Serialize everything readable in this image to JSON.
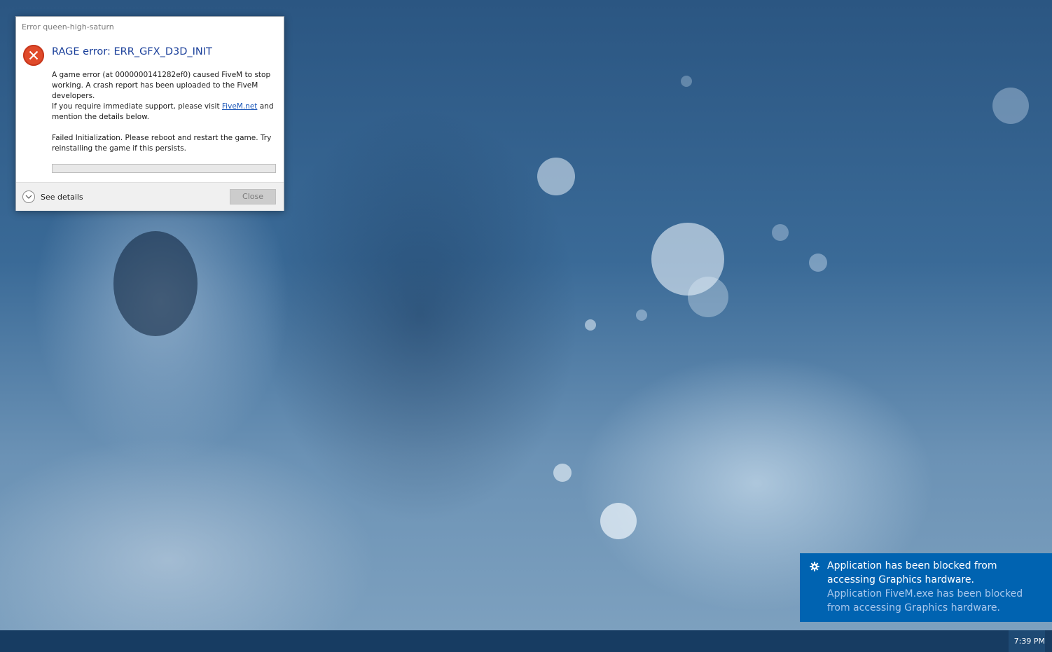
{
  "dialog": {
    "window_title": "Error queen-high-saturn",
    "heading": "RAGE error: ERR_GFX_D3D_INIT",
    "message": {
      "line_intro": "A game error (at 0000000141282ef0) caused FiveM to stop working. A crash report has been uploaded to the FiveM developers.",
      "support_prefix": "If you require immediate support, please visit ",
      "support_link": "FiveM.net",
      "support_suffix": " and mention the details below."
    },
    "detail": "Failed Initialization. Please reboot and restart the game. Try reinstalling the game if this persists.",
    "see_details_label": "See details",
    "close_label": "Close",
    "icon": "error-x-icon"
  },
  "toast": {
    "icon": "gear-icon",
    "title": "Application has been blocked from accessing Graphics hardware.",
    "body": "Application FiveM.exe has been blocked from accessing Graphics hardware."
  },
  "taskbar": {
    "clock": "7:39 PM"
  },
  "colors": {
    "toast_bg": "#0063b1",
    "error_red": "#e04a2a",
    "heading_blue": "#1a3f9a",
    "taskbar": "#173c62"
  }
}
